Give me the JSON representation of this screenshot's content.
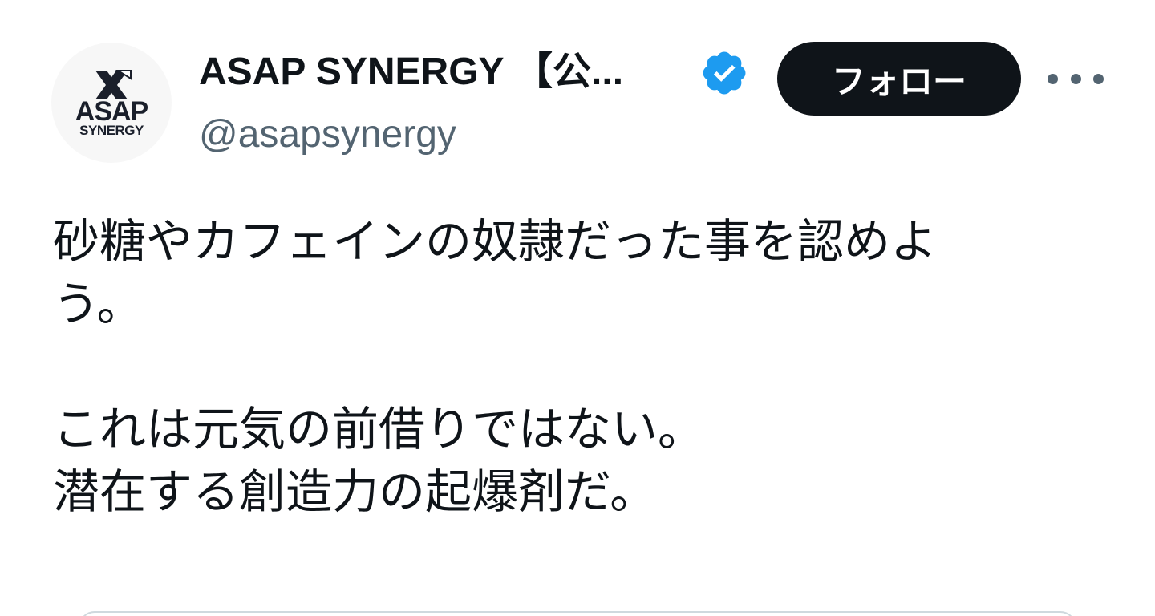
{
  "author": {
    "avatar_text_line1": "ASAP",
    "avatar_text_line2": "SYNERGY",
    "display_name": "ASAP SYNERGY 【公...",
    "handle": "@asapsynergy",
    "verified_icon": "verified-badge-icon",
    "verified_color": "#1d9bf0"
  },
  "actions": {
    "follow_label": "フォロー",
    "more_icon": "more-horizontal-icon"
  },
  "tweet": {
    "paragraph1": "砂糖やカフェインの奴隷だった事を認めよ\nう。",
    "paragraph2": "これは元気の前借りではない。\n潜在する創造力の起爆剤だ。"
  },
  "colors": {
    "text_primary": "#0f1419",
    "text_secondary": "#536471",
    "button_bg": "#0f1419",
    "border": "#cfd9de"
  }
}
